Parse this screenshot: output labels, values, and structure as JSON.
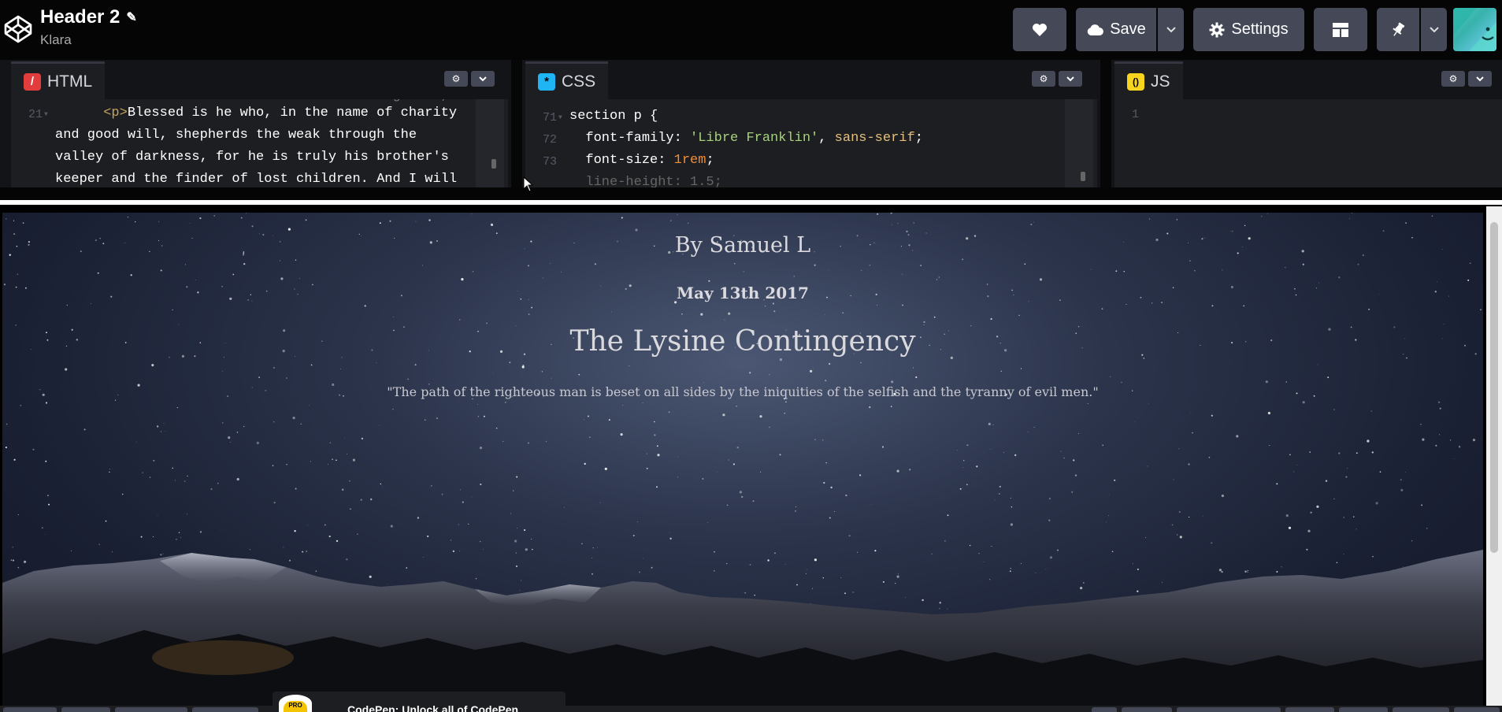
{
  "header": {
    "title": "Header 2",
    "author": "Klara",
    "save_label": "Save",
    "settings_label": "Settings"
  },
  "icons": {
    "logo": "codepen-logo-icon",
    "edit": "pencil-icon",
    "heart": "heart-icon",
    "save": "cloud-icon",
    "dropdown": "chevron-down-icon",
    "settings": "gear-icon",
    "layout": "layout-grid-icon",
    "pin": "pin-icon"
  },
  "editors": {
    "html": {
      "label": "HTML",
      "icon_color": "#e23c3c",
      "icon_glyph": "/",
      "gutter": [
        "21"
      ],
      "lines": [
        {
          "tag": "<p>",
          "text": "Blessed is he who, in the name of charity"
        },
        {
          "tag": "",
          "text": "and good will, shepherds the weak through the"
        },
        {
          "tag": "",
          "text": "valley of darkness, for he is truly his brother's"
        },
        {
          "tag": "",
          "text": "keeper and the finder of lost children. And I will"
        }
      ]
    },
    "css": {
      "label": "CSS",
      "icon_color": "#1fb5f5",
      "icon_glyph": "*",
      "gutter": [
        "71",
        "72",
        "73"
      ],
      "selector": "section p {",
      "decl1_prop": "font-family",
      "decl1_str": "'Libre Franklin'",
      "decl1_rest": "sans-serif",
      "decl2_prop": "font-size",
      "decl2_val": "1rem"
    },
    "js": {
      "label": "JS",
      "icon_color": "#f7d41e",
      "icon_glyph": "()",
      "gutter": [
        "1"
      ]
    }
  },
  "preview": {
    "byline": "By Samuel L",
    "date": "May 13th 2017",
    "headline": "The Lysine Contingency",
    "quote": "\"The path of the righteous man is beset on all sides by the iniquities of the selfish and the tyranny of evil men.\""
  },
  "promo": {
    "badge": "PRO",
    "text": "CodePen: Unlock all of CodePen"
  },
  "colors": {
    "topbar_bg": "#050505",
    "button_bg": "#444857",
    "editor_bg": "#1d1e22",
    "tag_color": "#c5a45e",
    "string_color": "#a6d27a",
    "number_color": "#f28c38",
    "keyword_color": "#e6c07b"
  }
}
